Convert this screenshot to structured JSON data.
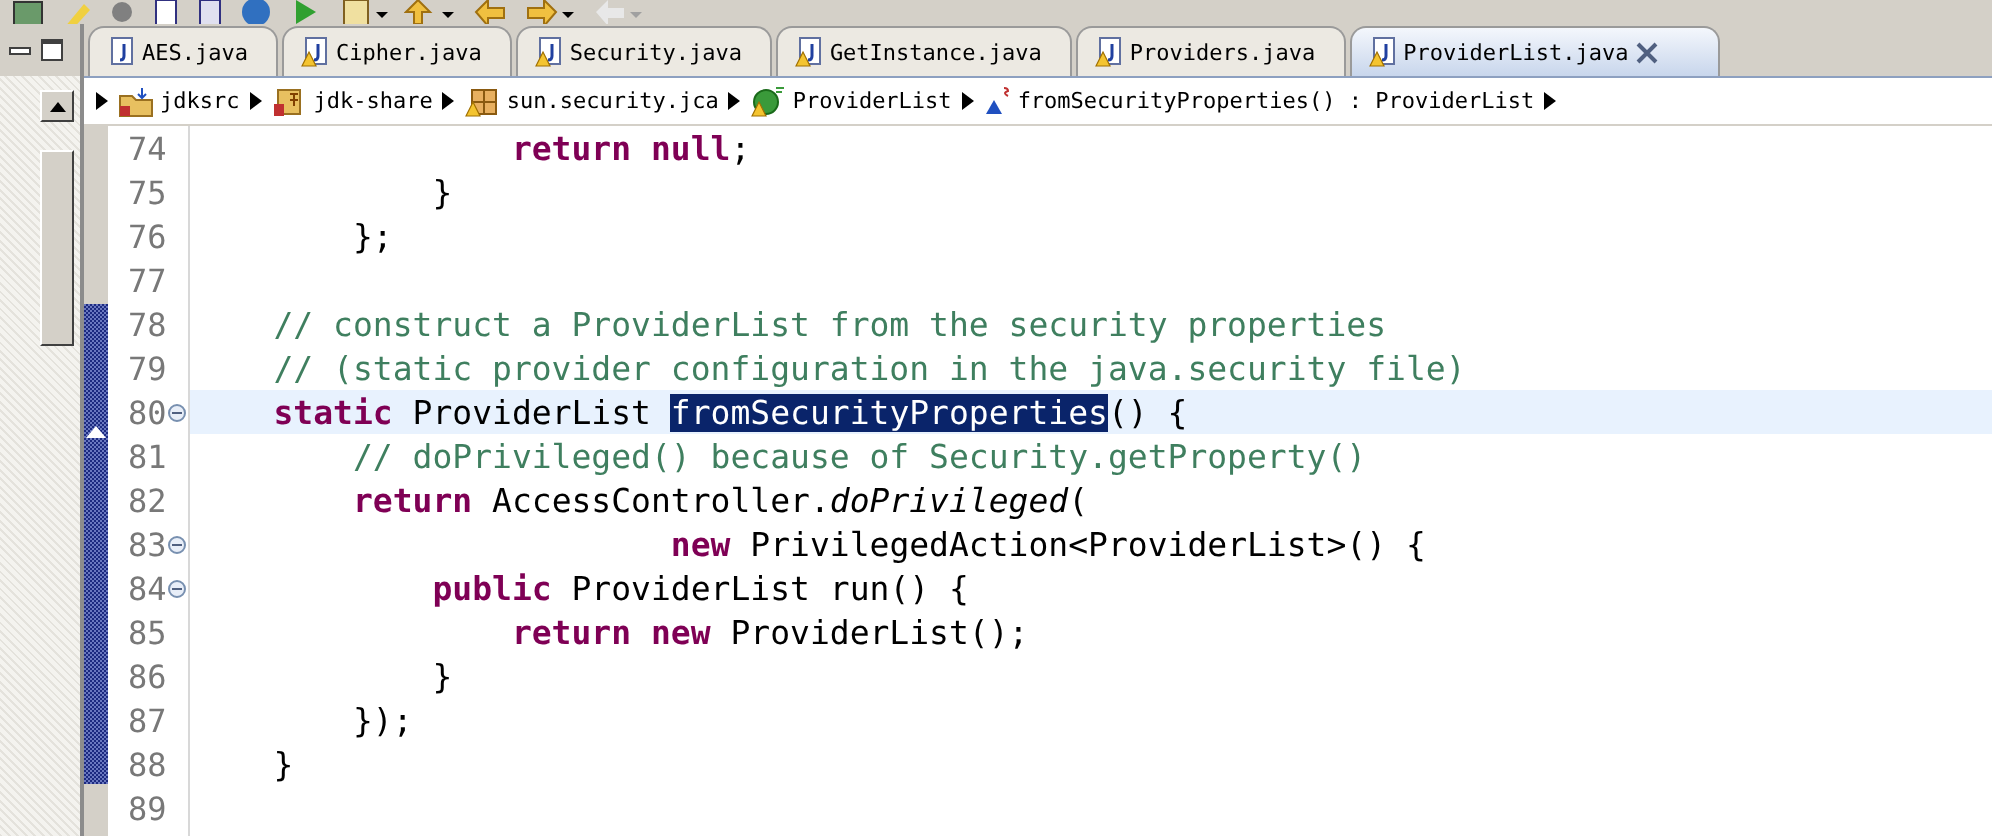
{
  "tabs": [
    {
      "label": "AES.java",
      "warning": false,
      "selected": false
    },
    {
      "label": "Cipher.java",
      "warning": true,
      "selected": false
    },
    {
      "label": "Security.java",
      "warning": true,
      "selected": false
    },
    {
      "label": "GetInstance.java",
      "warning": true,
      "selected": false
    },
    {
      "label": "Providers.java",
      "warning": true,
      "selected": false
    },
    {
      "label": "ProviderList.java",
      "warning": true,
      "selected": true
    }
  ],
  "breadcrumb": [
    {
      "label": "jdksrc",
      "kind": "project"
    },
    {
      "label": "jdk-share",
      "kind": "source"
    },
    {
      "label": "sun.security.jca",
      "kind": "package"
    },
    {
      "label": "ProviderList",
      "kind": "class"
    },
    {
      "label": "fromSecurityProperties() : ProviderList",
      "kind": "method"
    }
  ],
  "lines": [
    {
      "number": "74",
      "fold": false,
      "current": false,
      "tokens": [
        {
          "text": "                return null",
          "kind": "keyword"
        },
        {
          "text": ";",
          "kind": "plain"
        }
      ]
    },
    {
      "number": "75",
      "fold": false,
      "current": false,
      "tokens": [
        {
          "text": "            }",
          "kind": "plain"
        }
      ]
    },
    {
      "number": "76",
      "fold": false,
      "current": false,
      "tokens": [
        {
          "text": "        };",
          "kind": "plain"
        }
      ]
    },
    {
      "number": "77",
      "fold": false,
      "current": false
    },
    {
      "number": "78",
      "fold": false,
      "current": false,
      "tokens": [
        {
          "text": "    // construct a ProviderList from the security properties",
          "kind": "comment"
        }
      ]
    },
    {
      "number": "79",
      "fold": false,
      "current": false,
      "tokens": [
        {
          "text": "    // (static provider configuration in the java.security file)",
          "kind": "comment"
        }
      ]
    },
    {
      "number": "80",
      "fold": true,
      "current": true,
      "tokens": [
        {
          "text": "    static",
          "kind": "keyword"
        },
        {
          "text": " ProviderList ",
          "kind": "plain"
        },
        {
          "text": "fromSecurityProperties",
          "kind": "selection"
        },
        {
          "text": "() {",
          "kind": "plain"
        }
      ]
    },
    {
      "number": "81",
      "fold": false,
      "current": false,
      "tokens": [
        {
          "text": "        // doPrivileged() because of Security.getProperty()",
          "kind": "comment"
        }
      ]
    },
    {
      "number": "82",
      "fold": false,
      "current": false,
      "tokens": [
        {
          "text": "        return",
          "kind": "keyword"
        },
        {
          "text": " AccessController.",
          "kind": "plain"
        },
        {
          "text": "doPrivileged",
          "kind": "static"
        },
        {
          "text": "(",
          "kind": "plain"
        }
      ]
    },
    {
      "number": "83",
      "fold": true,
      "current": false,
      "tokens": [
        {
          "text": "                        new",
          "kind": "keyword"
        },
        {
          "text": " PrivilegedAction<ProviderList>() {",
          "kind": "plain"
        }
      ]
    },
    {
      "number": "84",
      "fold": true,
      "current": false,
      "tokens": [
        {
          "text": "            public",
          "kind": "keyword"
        },
        {
          "text": " ProviderList run() {",
          "kind": "plain"
        }
      ]
    },
    {
      "number": "85",
      "fold": false,
      "current": false,
      "tokens": [
        {
          "text": "                return new",
          "kind": "keyword"
        },
        {
          "text": " ProviderList();",
          "kind": "plain"
        }
      ]
    },
    {
      "number": "86",
      "fold": false,
      "current": false,
      "tokens": [
        {
          "text": "            }",
          "kind": "plain"
        }
      ]
    },
    {
      "number": "87",
      "fold": false,
      "current": false,
      "tokens": [
        {
          "text": "        });",
          "kind": "plain"
        }
      ]
    },
    {
      "number": "88",
      "fold": false,
      "current": false,
      "tokens": [
        {
          "text": "    }",
          "kind": "plain"
        }
      ]
    },
    {
      "number": "89",
      "fold": false,
      "current": false
    }
  ]
}
